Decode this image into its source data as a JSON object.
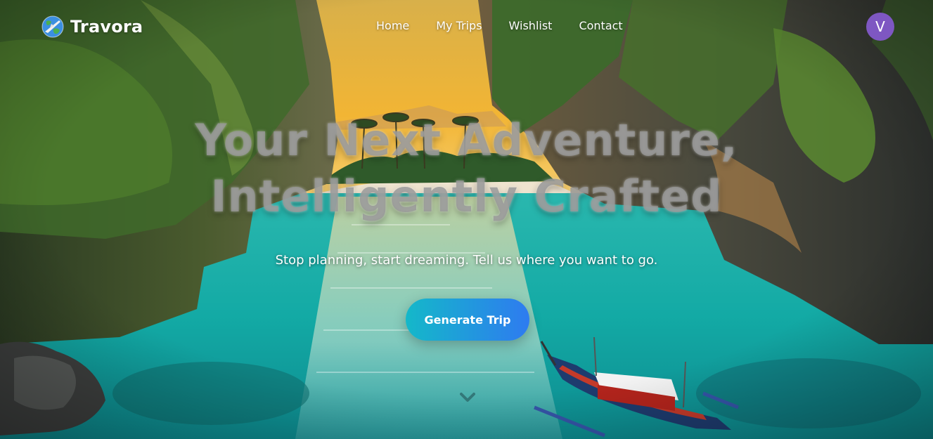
{
  "brand": {
    "name": "Travora",
    "icon": "globe-airplane-icon"
  },
  "nav": {
    "links": [
      {
        "label": "Home"
      },
      {
        "label": "My Trips"
      },
      {
        "label": "Wishlist"
      },
      {
        "label": "Contact"
      }
    ]
  },
  "user": {
    "avatar_initial": "V",
    "avatar_color": "#7e57c2"
  },
  "hero": {
    "title": "Your Next Adventure, Intelligently Crafted",
    "subtitle": "Stop planning, start dreaming. Tell us where you want to go.",
    "cta_label": "Generate Trip",
    "scroll_icon": "chevron-down-icon"
  },
  "colors": {
    "cta_gradient_start": "#14b8c9",
    "cta_gradient_end": "#2e7bf0",
    "water": "#18b5ad"
  }
}
